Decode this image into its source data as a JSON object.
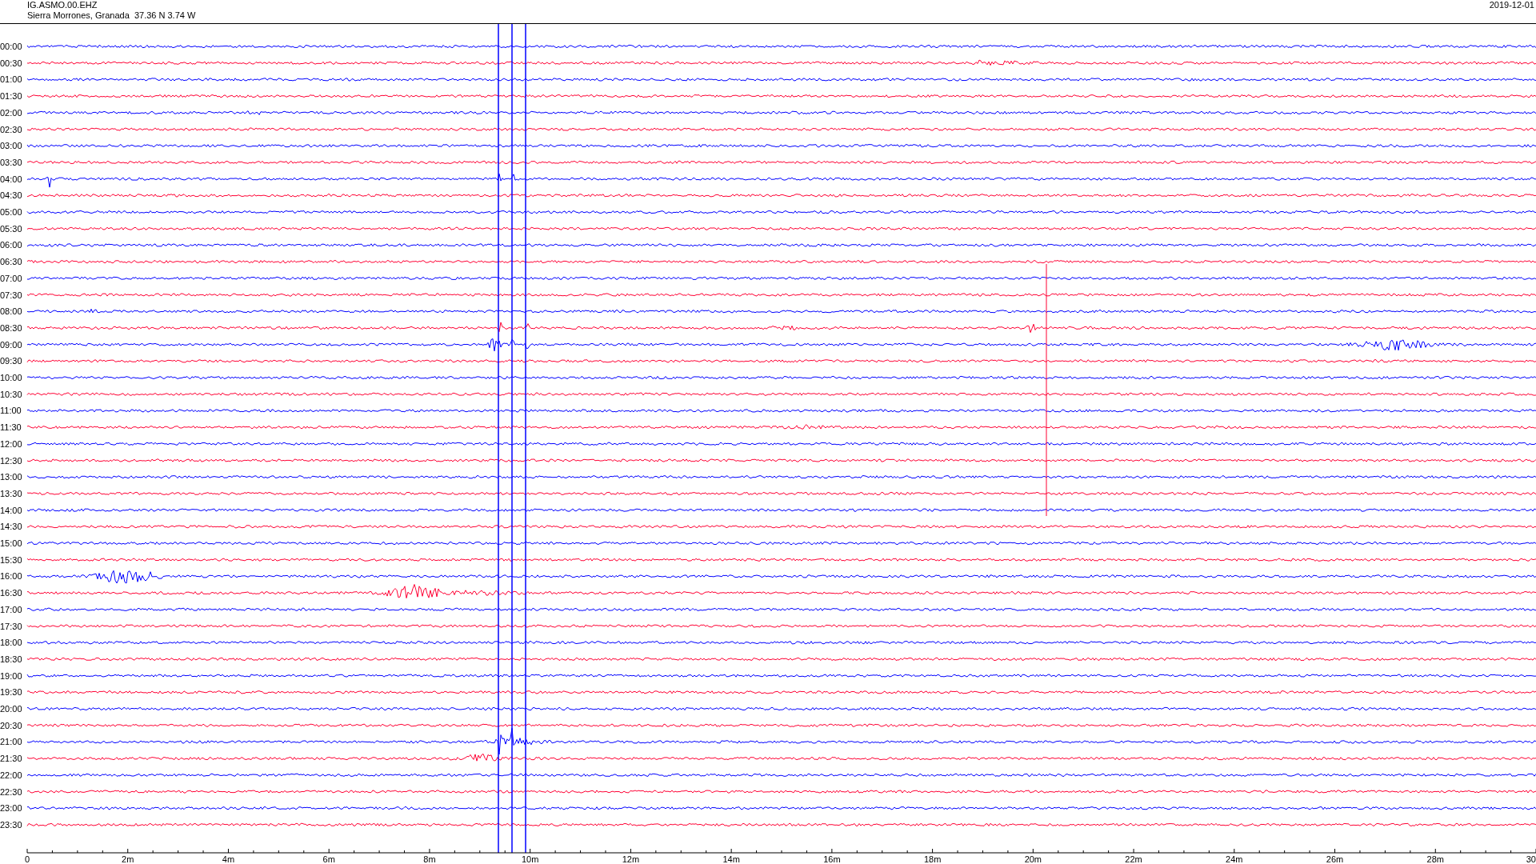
{
  "header": {
    "station": "IG.ASMO.00.EHZ",
    "location": "Sierra Morrones, Granada  37.36 N 3.74 W",
    "date": "2019-12-01"
  },
  "rows": [
    {
      "label": "00:00",
      "color": "#0000ff"
    },
    {
      "label": "00:30",
      "color": "#ff0033"
    },
    {
      "label": "01:00",
      "color": "#0000ff"
    },
    {
      "label": "01:30",
      "color": "#ff0033"
    },
    {
      "label": "02:00",
      "color": "#0000ff"
    },
    {
      "label": "02:30",
      "color": "#ff0033"
    },
    {
      "label": "03:00",
      "color": "#0000ff"
    },
    {
      "label": "03:30",
      "color": "#ff0033"
    },
    {
      "label": "04:00",
      "color": "#0000ff"
    },
    {
      "label": "04:30",
      "color": "#ff0033"
    },
    {
      "label": "05:00",
      "color": "#0000ff"
    },
    {
      "label": "05:30",
      "color": "#ff0033"
    },
    {
      "label": "06:00",
      "color": "#0000ff"
    },
    {
      "label": "06:30",
      "color": "#ff0033"
    },
    {
      "label": "07:00",
      "color": "#0000ff"
    },
    {
      "label": "07:30",
      "color": "#ff0033"
    },
    {
      "label": "08:00",
      "color": "#0000ff"
    },
    {
      "label": "08:30",
      "color": "#ff0033"
    },
    {
      "label": "09:00",
      "color": "#0000ff"
    },
    {
      "label": "09:30",
      "color": "#ff0033"
    },
    {
      "label": "10:00",
      "color": "#0000ff"
    },
    {
      "label": "10:30",
      "color": "#ff0033"
    },
    {
      "label": "11:00",
      "color": "#0000ff"
    },
    {
      "label": "11:30",
      "color": "#ff0033"
    },
    {
      "label": "12:00",
      "color": "#0000ff"
    },
    {
      "label": "12:30",
      "color": "#ff0033"
    },
    {
      "label": "13:00",
      "color": "#0000ff"
    },
    {
      "label": "13:30",
      "color": "#ff0033"
    },
    {
      "label": "14:00",
      "color": "#0000ff"
    },
    {
      "label": "14:30",
      "color": "#ff0033"
    },
    {
      "label": "15:00",
      "color": "#0000ff"
    },
    {
      "label": "15:30",
      "color": "#ff0033"
    },
    {
      "label": "16:00",
      "color": "#0000ff"
    },
    {
      "label": "16:30",
      "color": "#ff0033"
    },
    {
      "label": "17:00",
      "color": "#0000ff"
    },
    {
      "label": "17:30",
      "color": "#ff0033"
    },
    {
      "label": "18:00",
      "color": "#0000ff"
    },
    {
      "label": "18:30",
      "color": "#ff0033"
    },
    {
      "label": "19:00",
      "color": "#0000ff"
    },
    {
      "label": "19:30",
      "color": "#ff0033"
    },
    {
      "label": "20:00",
      "color": "#0000ff"
    },
    {
      "label": "20:30",
      "color": "#ff0033"
    },
    {
      "label": "21:00",
      "color": "#0000ff"
    },
    {
      "label": "21:30",
      "color": "#ff0033"
    },
    {
      "label": "22:00",
      "color": "#0000ff"
    },
    {
      "label": "22:30",
      "color": "#ff0033"
    },
    {
      "label": "23:00",
      "color": "#0000ff"
    },
    {
      "label": "23:30",
      "color": "#ff0033"
    }
  ],
  "x_axis": {
    "labels": [
      "0",
      "2m",
      "4m",
      "6m",
      "8m",
      "10m",
      "12m",
      "14m",
      "16m",
      "18m",
      "20m",
      "22m",
      "24m",
      "26m",
      "28m",
      "30"
    ]
  }
}
